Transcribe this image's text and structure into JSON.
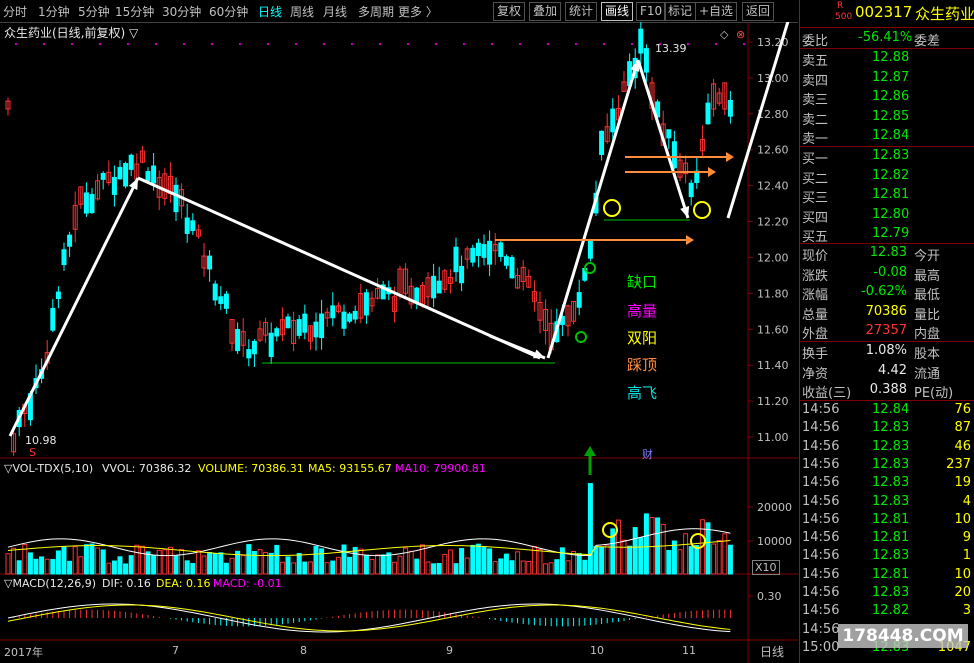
{
  "toolbar": {
    "periods": [
      "分时",
      "1分钟",
      "5分钟",
      "15分钟",
      "30分钟",
      "60分钟",
      "日线",
      "周线",
      "月线",
      "多周期",
      "更多 〉"
    ],
    "active_period": "日线",
    "buttons": [
      "复权",
      "叠加",
      "统计",
      "画线",
      "F10",
      "标记",
      "+自选",
      "返回"
    ],
    "active_button": "画线"
  },
  "chart": {
    "title": "众生药业(日线,前复权) ▽",
    "high_label": "13.39",
    "low_label": "10.98",
    "price_axis": [
      "13.00",
      "12.80",
      "12.60",
      "12.40",
      "12.20",
      "12.00",
      "11.80",
      "11.60",
      "11.40",
      "11.20",
      "11.00"
    ],
    "price_axis_top": "13.20",
    "legend": [
      {
        "text": "缺口",
        "color": "#00e600"
      },
      {
        "text": "高量",
        "color": "#ff00ff"
      },
      {
        "text": "双阳",
        "color": "#ffff00"
      },
      {
        "text": "踩顶",
        "color": "#ff8c3a"
      },
      {
        "text": "高飞",
        "color": "#00e0e0"
      }
    ],
    "vol_header": {
      "name": "▽VOL-TDX(5,10)",
      "vvol": "VVOL: 70386.32",
      "volume": "VOLUME: 70386.31",
      "ma5": "MA5: 93155.67",
      "ma10": "MA10: 79900.81"
    },
    "vol_axis": [
      "20000",
      "10000"
    ],
    "vol_unit": "X10",
    "macd_header": {
      "name": "▽MACD(12,26,9)",
      "dif": "DIF: 0.16",
      "dea": "DEA: 0.16",
      "macd": "MACD: -0.01"
    },
    "macd_axis": [
      "0.30"
    ],
    "x_axis": [
      "2017年",
      "7",
      "8",
      "9",
      "10",
      "11"
    ],
    "x_axis_right": "日线",
    "marker_s": "S",
    "marker_cai": "财"
  },
  "quote": {
    "code": "002317",
    "name": "众生药业",
    "badge_r": "R",
    "badge_500": "500",
    "weibi_label": "委比",
    "weibi_value": "-56.41%",
    "weicha_label": "委差",
    "sells": [
      {
        "label": "卖五",
        "price": "12.88"
      },
      {
        "label": "卖四",
        "price": "12.87"
      },
      {
        "label": "卖三",
        "price": "12.86"
      },
      {
        "label": "卖二",
        "price": "12.85"
      },
      {
        "label": "卖一",
        "price": "12.84"
      }
    ],
    "buys": [
      {
        "label": "买一",
        "price": "12.83"
      },
      {
        "label": "买二",
        "price": "12.82"
      },
      {
        "label": "买三",
        "price": "12.81"
      },
      {
        "label": "买四",
        "price": "12.80"
      },
      {
        "label": "买五",
        "price": "12.79"
      }
    ],
    "stats": [
      {
        "label": "现价",
        "value": "12.83",
        "color": "green",
        "label2": "今开"
      },
      {
        "label": "涨跌",
        "value": "-0.08",
        "color": "green",
        "label2": "最高"
      },
      {
        "label": "涨幅",
        "value": "-0.62%",
        "color": "green",
        "label2": "最低"
      },
      {
        "label": "总量",
        "value": "70386",
        "color": "yellow",
        "label2": "量比"
      },
      {
        "label": "外盘",
        "value": "27357",
        "color": "red",
        "label2": "内盘"
      }
    ],
    "stats2": [
      {
        "label": "换手",
        "value": "1.08%",
        "label2": "股本"
      },
      {
        "label": "净资",
        "value": "4.42",
        "label2": "流通"
      },
      {
        "label": "收益(三)",
        "value": "0.388",
        "label2": "PE(动)"
      }
    ],
    "ticks": [
      {
        "time": "14:56",
        "price": "12.84",
        "pcolor": "green",
        "vol": "76"
      },
      {
        "time": "14:56",
        "price": "12.83",
        "pcolor": "green",
        "vol": "87"
      },
      {
        "time": "14:56",
        "price": "12.83",
        "pcolor": "green",
        "vol": "46"
      },
      {
        "time": "14:56",
        "price": "12.83",
        "pcolor": "green",
        "vol": "237"
      },
      {
        "time": "14:56",
        "price": "12.83",
        "pcolor": "green",
        "vol": "19"
      },
      {
        "time": "14:56",
        "price": "12.83",
        "pcolor": "green",
        "vol": "4"
      },
      {
        "time": "14:56",
        "price": "12.81",
        "pcolor": "green",
        "vol": "10"
      },
      {
        "time": "14:56",
        "price": "12.81",
        "pcolor": "green",
        "vol": "9"
      },
      {
        "time": "14:56",
        "price": "12.83",
        "pcolor": "green",
        "vol": "1"
      },
      {
        "time": "14:56",
        "price": "12.81",
        "pcolor": "green",
        "vol": "10"
      },
      {
        "time": "14:56",
        "price": "12.83",
        "pcolor": "green",
        "vol": "20"
      },
      {
        "time": "14:56",
        "price": "12.82",
        "pcolor": "green",
        "vol": "3"
      },
      {
        "time": "14:56",
        "price": "",
        "pcolor": "green",
        "vol": ""
      },
      {
        "time": "15:00",
        "price": "12.83",
        "pcolor": "green",
        "vol": "1047"
      }
    ],
    "watermark": "178448.COM"
  },
  "colors": {
    "up": "#ff3232",
    "down": "#00ffff",
    "grid": "#800000",
    "ma5": "#ffffff",
    "ma10": "#ffff00",
    "arrow": "#ffffff",
    "trendline": "#ff8c3a",
    "support": "#00c000"
  }
}
